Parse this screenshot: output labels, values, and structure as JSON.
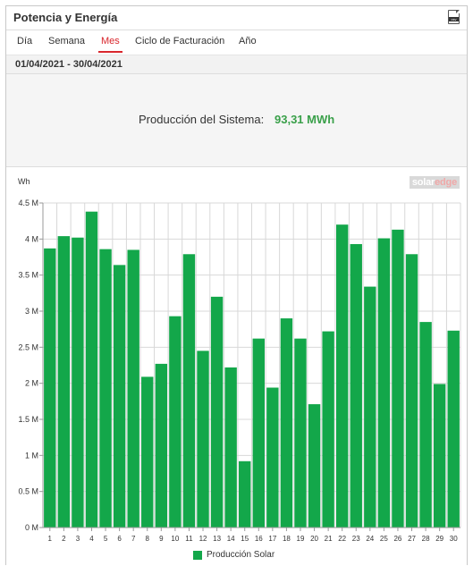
{
  "header": {
    "title": "Potencia y Energía",
    "export_icon": "csv-file-icon",
    "export_label": "csv"
  },
  "tabs": [
    {
      "label": "Día"
    },
    {
      "label": "Semana"
    },
    {
      "label": "Mes",
      "active": true
    },
    {
      "label": "Ciclo de Facturación"
    },
    {
      "label": "Año"
    }
  ],
  "date_range": "01/04/2021 - 30/04/2021",
  "summary": {
    "label": "Producción del Sistema:",
    "value": "93,31 MWh",
    "value_color": "#3aa04a"
  },
  "logo": {
    "part1": "solar",
    "part2": "edge"
  },
  "colors": {
    "accent": "#d9262c",
    "bar": "#13a74a"
  },
  "chart_data": {
    "type": "bar",
    "unit_label": "Wh",
    "categories": [
      "1",
      "2",
      "3",
      "4",
      "5",
      "6",
      "7",
      "8",
      "9",
      "10",
      "11",
      "12",
      "13",
      "14",
      "15",
      "16",
      "17",
      "18",
      "19",
      "20",
      "21",
      "22",
      "23",
      "24",
      "25",
      "26",
      "27",
      "28",
      "29",
      "30"
    ],
    "series": [
      {
        "name": "Producción Solar",
        "values": [
          3.87,
          4.04,
          4.02,
          4.38,
          3.86,
          3.64,
          3.85,
          2.09,
          2.27,
          2.93,
          3.79,
          2.45,
          3.2,
          2.22,
          0.92,
          2.62,
          1.94,
          2.9,
          2.62,
          1.71,
          2.72,
          4.2,
          3.93,
          3.34,
          4.01,
          4.13,
          3.79,
          2.85,
          1.99,
          2.73
        ]
      }
    ],
    "y_scale_label": "M",
    "yticks": [
      "0 M",
      "0.5 M",
      "1 M",
      "1.5 M",
      "2 M",
      "2.5 M",
      "3 M",
      "3.5 M",
      "4 M",
      "4.5 M"
    ],
    "ylim": [
      0,
      4.5
    ],
    "grid": true,
    "legend_position": "bottom"
  }
}
